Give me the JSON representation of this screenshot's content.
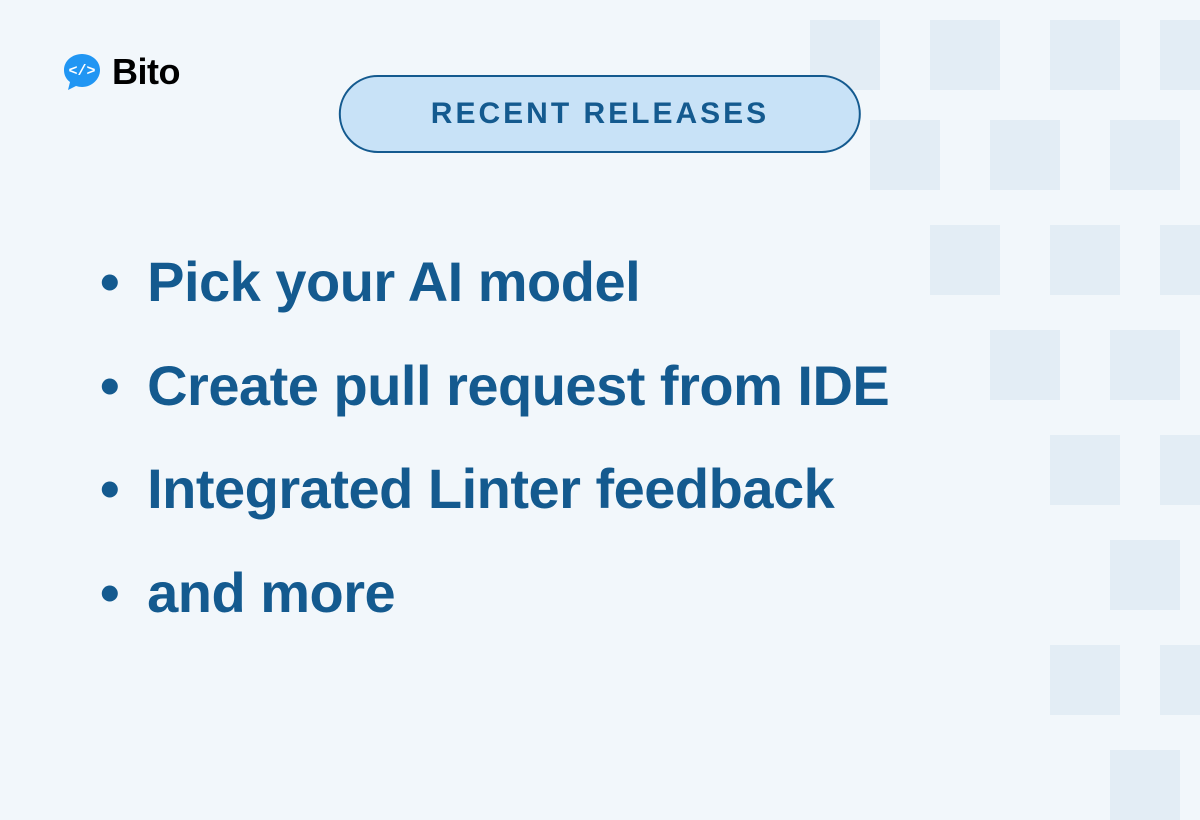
{
  "logo": {
    "name": "Bito"
  },
  "badge": {
    "label": "RECENT RELEASES"
  },
  "features": [
    "Pick your AI model",
    "Create pull request from IDE",
    "Integrated Linter feedback",
    "and more"
  ]
}
